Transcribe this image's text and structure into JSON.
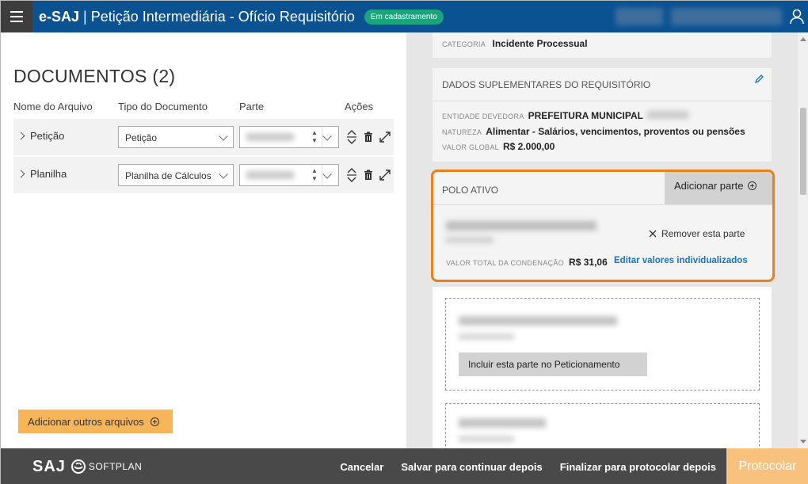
{
  "header": {
    "brand": "e-SAJ",
    "separator": "|",
    "title": "Petição Intermediária - Ofício Requisitório",
    "status_badge": "Em cadastramento",
    "menu_icon": "hamburger-icon",
    "user_icon": "user-icon"
  },
  "documents": {
    "heading": "DOCUMENTOS (2)",
    "columns": [
      "Nome do Arquivo",
      "Tipo do Documento",
      "Parte",
      "Ações"
    ],
    "rows": [
      {
        "name": "Petição",
        "type": "Petição"
      },
      {
        "name": "Planilha",
        "type": "Planilha de Cálculos"
      }
    ],
    "add_files_label": "Adicionar outros arquivos"
  },
  "summary": {
    "categoria_label": "CATEGORIA",
    "categoria_value": "Incidente Processual",
    "supl_title": "DADOS SUPLEMENTARES DO REQUISITÓRIO",
    "entidade_label": "ENTIDADE DEVEDORA",
    "entidade_value": "PREFEITURA MUNICIPAL",
    "natureza_label": "NATUREZA",
    "natureza_value": "Alimentar - Salários, vencimentos, proventos ou pensões",
    "valor_global_label": "VALOR GLOBAL",
    "valor_global_value": "R$ 2.000,00"
  },
  "polo_ativo": {
    "title": "POLO ATIVO",
    "add_parte_label": "Adicionar parte",
    "remove_label": "Remover esta parte",
    "valor_total_label": "VALOR TOTAL DA CONDENAÇÃO",
    "valor_total_value": "R$ 31,06",
    "edit_link": "Editar valores individualizados"
  },
  "candidates": {
    "include_label": "Incluir esta parte no Peticionamento"
  },
  "footer": {
    "logo_text": "SAJ",
    "softplan": "SOFTPLAN",
    "cancel": "Cancelar",
    "save_later": "Salvar para continuar depois",
    "finalize_later": "Finalizar para protocolar depois",
    "protocol": "Protocolar"
  },
  "colors": {
    "header_bg": "#0b5293",
    "status_green": "#1aa67a",
    "highlight_orange": "#e8801e",
    "add_button": "#f8b459",
    "protocol_button": "#f8c27e",
    "footer_bg": "#494949",
    "link_blue": "#1a73c8"
  }
}
